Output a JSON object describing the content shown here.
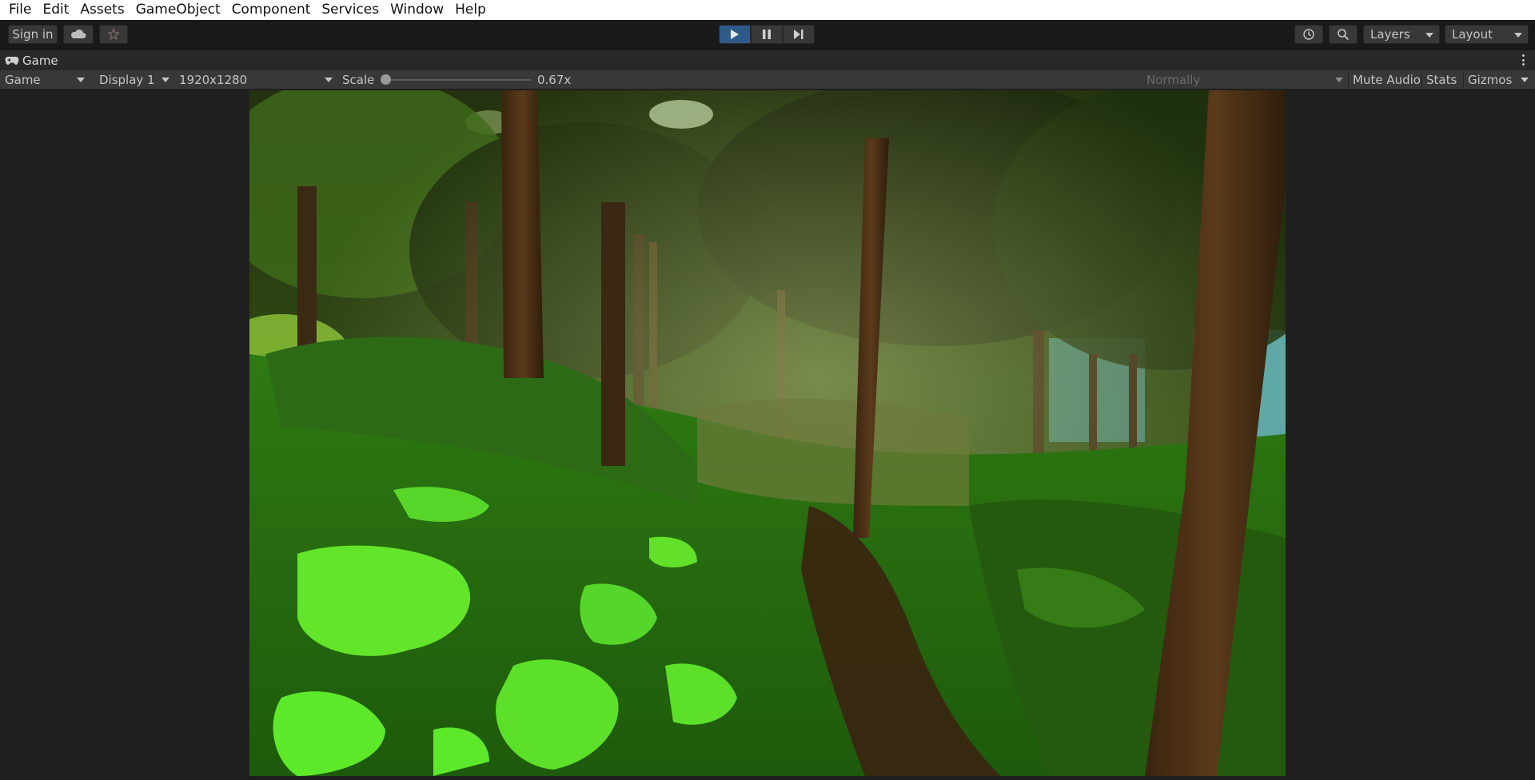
{
  "menu": [
    "File",
    "Edit",
    "Assets",
    "GameObject",
    "Component",
    "Services",
    "Window",
    "Help"
  ],
  "toolbar": {
    "sign_in": "Sign in",
    "layers": "Layers",
    "layout": "Layout",
    "play_state": "playing",
    "icons": [
      "cloud-icon",
      "collab-icon",
      "play-icon",
      "pause-icon",
      "step-icon",
      "history-icon",
      "search-icon"
    ]
  },
  "tab": {
    "title": "Game",
    "icon": "gamepad-icon"
  },
  "game_controls": {
    "view": "Game",
    "display": "Display 1",
    "resolution": "1920x1280",
    "scale_label": "Scale",
    "scale_value": "0.67x",
    "play_mode": "Normally",
    "mute_audio": "Mute Audio",
    "stats": "Stats",
    "gizmos": "Gizmos"
  },
  "colors": {
    "accent_play": "#2e5a8a",
    "grass_bright": "#5ee82a",
    "grass_dark": "#1f5a0e",
    "trunk": "#4a2f16",
    "sky": "#5aa6a8"
  }
}
